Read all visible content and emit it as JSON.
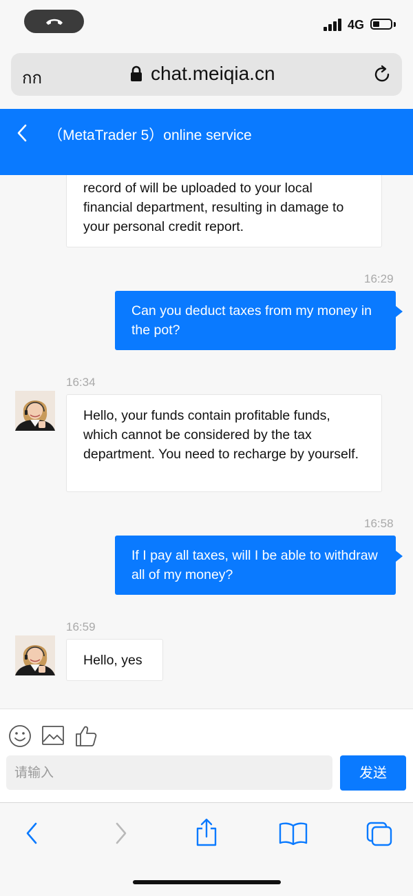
{
  "status_bar": {
    "network": "4G",
    "signal_bars": 4,
    "battery_level": 0.35
  },
  "browser": {
    "text_size_label": "กก",
    "url": "chat.meiqia.cn"
  },
  "header": {
    "title": "（MetaTrader 5）online service"
  },
  "messages": [
    {
      "side": "in",
      "avatar": false,
      "time": "",
      "text": "record of will be uploaded to your local financial department, resulting in damage to your personal credit report."
    },
    {
      "side": "out",
      "time": "16:29",
      "text": "Can you deduct taxes from my money in the pot?"
    },
    {
      "side": "in",
      "avatar": true,
      "time": "16:34",
      "text": "Hello, your funds contain profitable funds, which cannot be considered by the tax department. You need to recharge by yourself."
    },
    {
      "side": "out",
      "time": "16:58",
      "text": "If I pay all taxes, will I be able to withdraw all of my money?"
    },
    {
      "side": "in",
      "avatar": true,
      "time": "16:59",
      "text": "Hello, yes"
    }
  ],
  "composer": {
    "tools": [
      "smiley-icon",
      "image-icon",
      "thumbs-up-icon"
    ],
    "placeholder": "请输入",
    "send_label": "发送"
  },
  "safari_toolbar": [
    "back-icon",
    "forward-icon",
    "share-icon",
    "bookmarks-icon",
    "tabs-icon"
  ],
  "colors": {
    "accent": "#0a7aff",
    "background": "#f7f7f7",
    "timestamp": "#a9a9a9"
  }
}
